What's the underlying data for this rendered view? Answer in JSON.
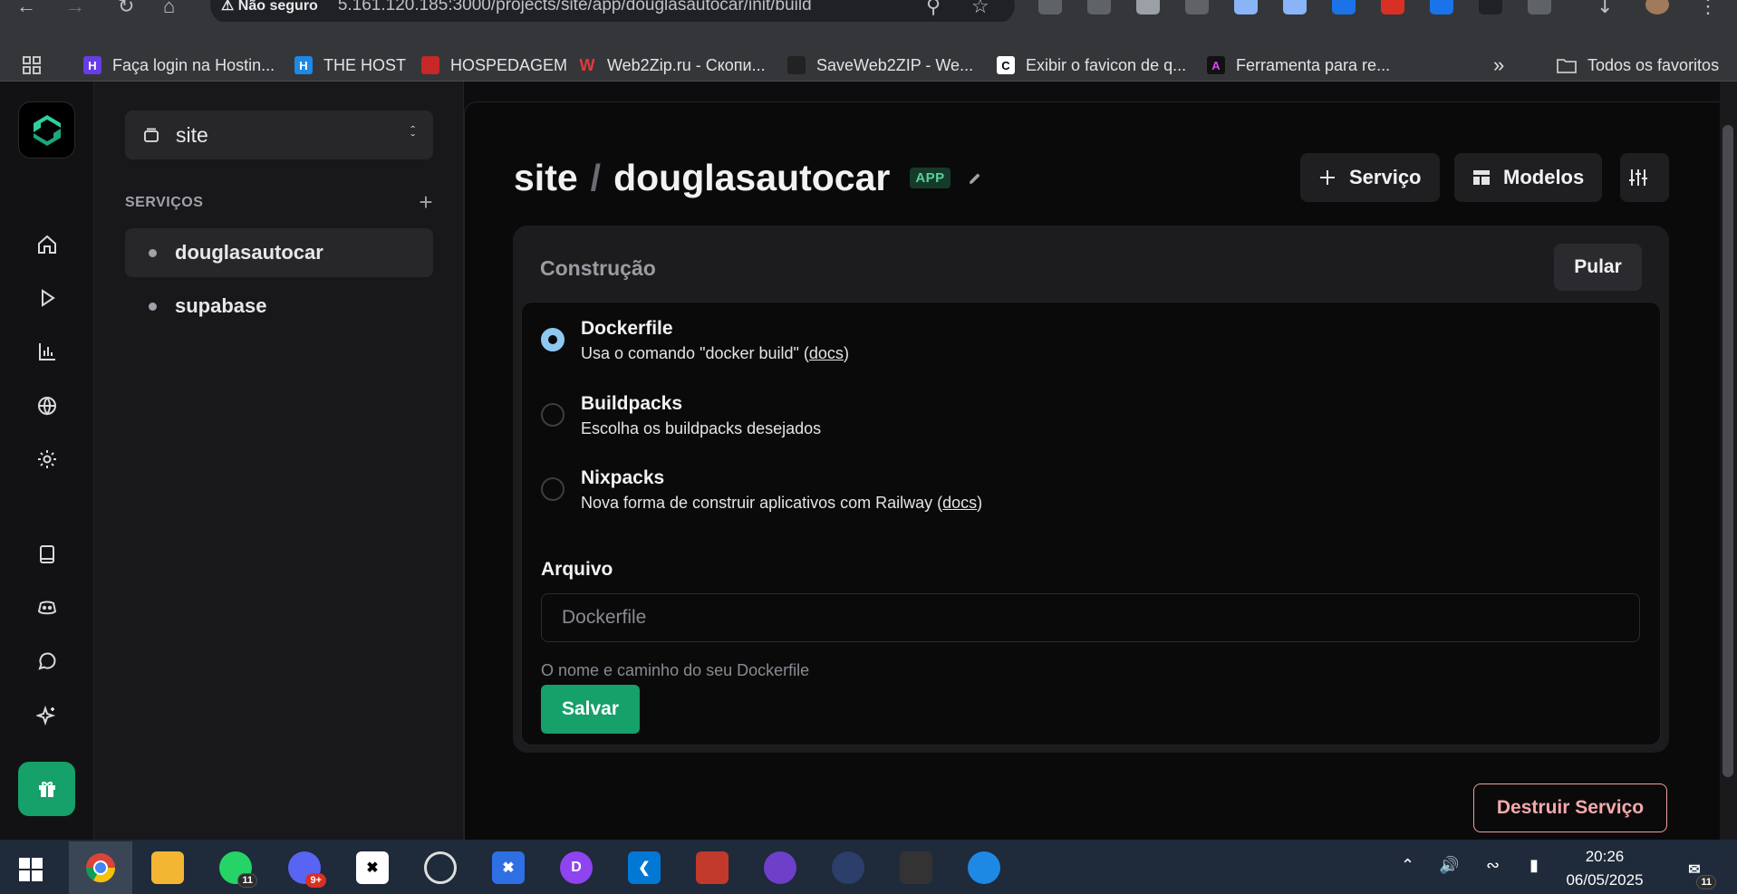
{
  "browser": {
    "security_label": "Não seguro",
    "url": "5.161.120.185:3000/projects/site/app/douglasautocar/init/build",
    "bookmarks": [
      {
        "label": "Faça login na Hostin...",
        "color": "#673de6"
      },
      {
        "label": "THE HOST",
        "color": "#1e88e5"
      },
      {
        "label": "HOSPEDAGEM",
        "color": "#c62828"
      },
      {
        "label": "Web2Zip.ru - Скопи...",
        "color": "#e53935"
      },
      {
        "label": "SaveWeb2ZIP - We...",
        "color": "#222222"
      },
      {
        "label": "Exibir o favicon de q...",
        "color": "#ffffff"
      },
      {
        "label": "Ferramenta para re...",
        "color": "#111111"
      }
    ],
    "all_bookmarks_label": "Todos os favoritos"
  },
  "rail": {
    "icons": [
      "home-icon",
      "play-icon",
      "chart-icon",
      "globe-icon",
      "settings-icon",
      "book-icon",
      "discord-icon",
      "chat-icon",
      "sparkles-icon",
      "gift-icon"
    ]
  },
  "sidebar": {
    "project_name": "site",
    "services_header": "SERVIÇOS",
    "services": [
      {
        "label": "douglasautocar",
        "active": true
      },
      {
        "label": "supabase",
        "active": false
      }
    ]
  },
  "header": {
    "project": "site",
    "separator": "/",
    "service": "douglasautocar",
    "badge": "APP",
    "add_service_label": "Serviço",
    "templates_label": "Modelos"
  },
  "build": {
    "title": "Construção",
    "skip_label": "Pular",
    "options": [
      {
        "title": "Dockerfile",
        "desc": "Usa o comando \"docker build\" (",
        "link": "docs",
        "desc_end": ")",
        "selected": true
      },
      {
        "title": "Buildpacks",
        "desc": "Escolha os buildpacks desejados",
        "link": "",
        "desc_end": "",
        "selected": false
      },
      {
        "title": "Nixpacks",
        "desc": "Nova forma de construir aplicativos com Railway (",
        "link": "docs",
        "desc_end": ")",
        "selected": false
      }
    ],
    "file_label": "Arquivo",
    "file_placeholder": "Dockerfile",
    "file_hint": "O nome e caminho do seu Dockerfile",
    "save_label": "Salvar"
  },
  "destroy_label": "Destruir Serviço",
  "taskbar": {
    "time": "20:26",
    "date": "06/05/2025",
    "whatsapp_badge": "11",
    "discord_badge": "9+",
    "notifications_badge": "11"
  }
}
